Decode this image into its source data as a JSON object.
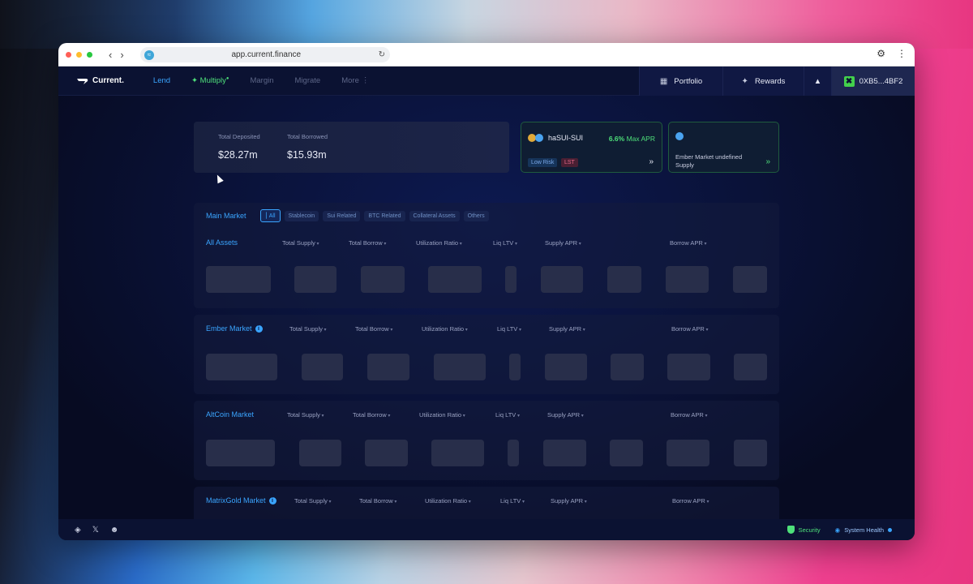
{
  "browser": {
    "url": "app.current.finance",
    "traffic_colors": [
      "#ff5f57",
      "#febc2e",
      "#28c840"
    ]
  },
  "header": {
    "logo": "Current.",
    "nav": [
      {
        "label": "Lend",
        "state": "active"
      },
      {
        "label": "Multiply",
        "state": "highlight"
      },
      {
        "label": "Margin",
        "state": "normal"
      },
      {
        "label": "Migrate",
        "state": "normal"
      },
      {
        "label": "More",
        "state": "normal"
      }
    ],
    "portfolio": "Portfolio",
    "rewards": "Rewards",
    "wallet": "0XB5...4BF2"
  },
  "stats": {
    "deposited_label": "Total Deposited",
    "deposited_value": "$28.27m",
    "borrowed_label": "Total Borrowed",
    "borrowed_value": "$15.93m"
  },
  "promo1": {
    "title": "haSUI-SUI",
    "apr_value": "6.6%",
    "apr_label": "Max APR",
    "tag1": "Low Risk",
    "tag2": "LST"
  },
  "promo2": {
    "text": "Ember Market undefined Supply"
  },
  "filters": {
    "title": "Main Market",
    "chips": [
      "All",
      "Stablecoin",
      "Sui Related",
      "BTC Related",
      "Collateral Assets",
      "Others"
    ]
  },
  "columns": [
    "Total Supply",
    "Total Borrow",
    "Utilization Ratio",
    "Liq LTV",
    "Supply APR",
    "Borrow APR"
  ],
  "markets": [
    {
      "title": "All Assets",
      "info": false
    },
    {
      "title": "Ember Market",
      "info": true
    },
    {
      "title": "AltCoin Market",
      "info": false
    },
    {
      "title": "MatrixGold Market",
      "info": true
    }
  ],
  "footer": {
    "security": "Security",
    "health": "System Health"
  },
  "colors": {
    "accent": "#3aa5ff",
    "green": "#4ee07a",
    "bg": "#070b22"
  }
}
